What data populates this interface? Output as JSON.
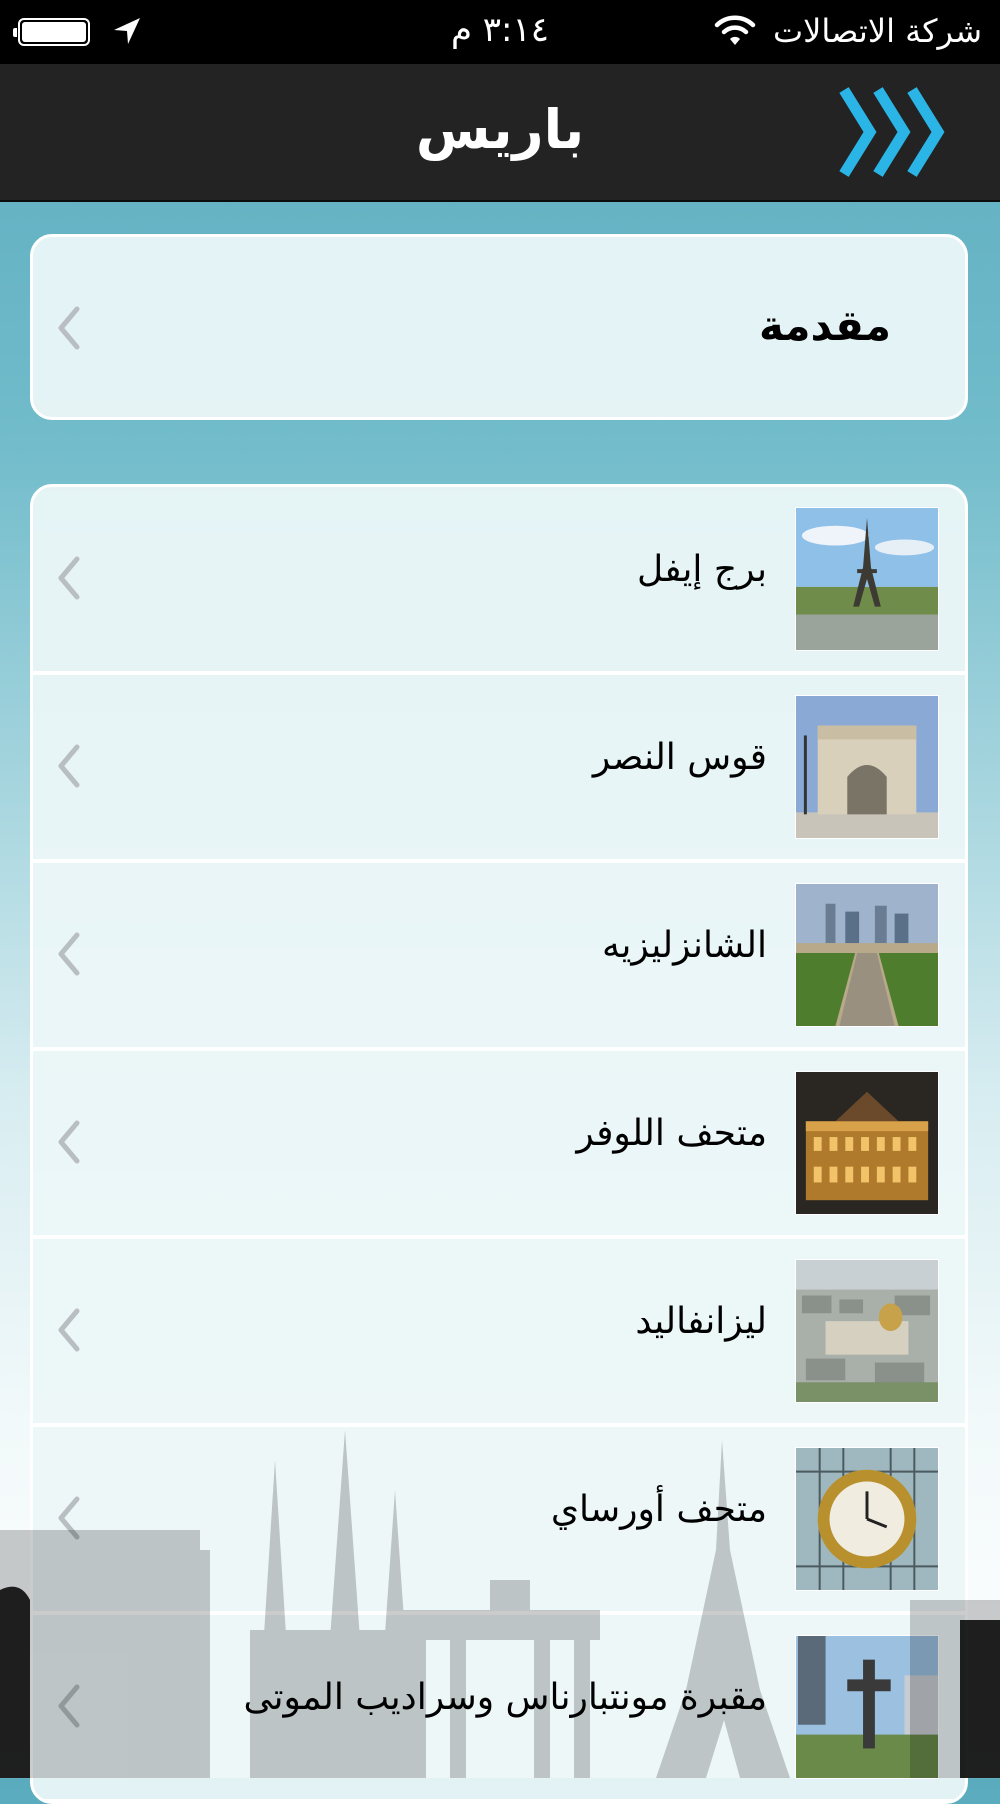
{
  "status_bar": {
    "carrier": "شركة الاتصالات",
    "time": "٣:١٤ م",
    "wifi_icon": "wifi-icon",
    "location_icon": "location-arrow-icon",
    "battery_icon": "battery-icon"
  },
  "nav": {
    "title": "باريس",
    "menu_icon": "triple-chevron-icon"
  },
  "intro": {
    "label": "مقدمة"
  },
  "places": [
    {
      "label": "برج إيفل",
      "thumb": "eiffel-tower-photo"
    },
    {
      "label": "قوس النصر",
      "thumb": "arc-de-triomphe-photo"
    },
    {
      "label": "الشانزليزيه",
      "thumb": "champs-elysees-photo"
    },
    {
      "label": "متحف اللوفر",
      "thumb": "louvre-photo"
    },
    {
      "label": "ليزانفاليد",
      "thumb": "les-invalides-photo"
    },
    {
      "label": "متحف أورساي",
      "thumb": "orsay-clock-photo"
    },
    {
      "label": "مقبرة مونتبارناس وسراديب الموتى",
      "thumb": "montparnasse-cemetery-photo"
    }
  ],
  "colors": {
    "accent": "#2bb5e6",
    "nav_bg": "#232323",
    "card_bg": "#ecf6f8"
  }
}
